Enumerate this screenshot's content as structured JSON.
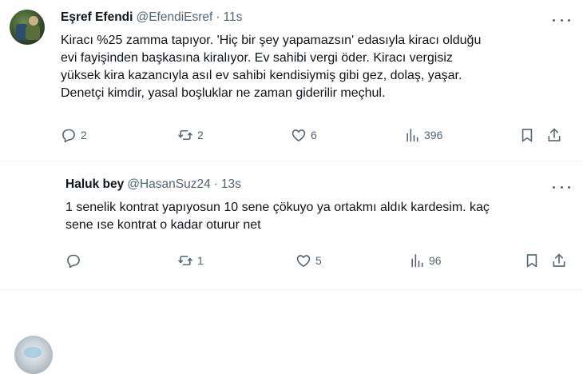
{
  "tweets": [
    {
      "name": "Eşref Efendi",
      "handle": "@EfendiEsref",
      "dot": "·",
      "time": "11s",
      "text": "Kiracı %25 zamma tapıyor. 'Hiç bir şey yapamazsın' edasıyla kiracı olduğu\nevi fayişinden başkasına kiralıyor. Ev sahibi vergi öder. Kiracı vergisiz\nyüksek kira kazancıyla asıl ev sahibi kendisiymiş gibi gez, dolaş, yaşar.\nDenetçi kimdir, yasal boşluklar ne zaman giderilir meçhul.",
      "replies": "2",
      "reposts": "2",
      "likes": "6",
      "views": "396"
    },
    {
      "name": "Haluk bey",
      "handle": "@HasanSuz24",
      "dot": "·",
      "time": "13s",
      "text": "1 senelik kontrat yapıyosun 10 sene çökuyo ya ortakmı aldık kardesim. kaç\nsene ıse kontrat o kadar oturur net",
      "replies": "",
      "reposts": "1",
      "likes": "5",
      "views": "96"
    }
  ],
  "icons": {
    "reply": "speech-bubble-icon",
    "repost": "repost-arrows-icon",
    "like": "heart-icon",
    "views": "bar-chart-icon",
    "bookmark": "bookmark-icon",
    "share": "share-upload-icon",
    "more": "three-dots-icon"
  },
  "colors": {
    "text": "#0f1419",
    "secondary": "#536471",
    "divider": "#eff3f4",
    "background": "#ffffff"
  }
}
